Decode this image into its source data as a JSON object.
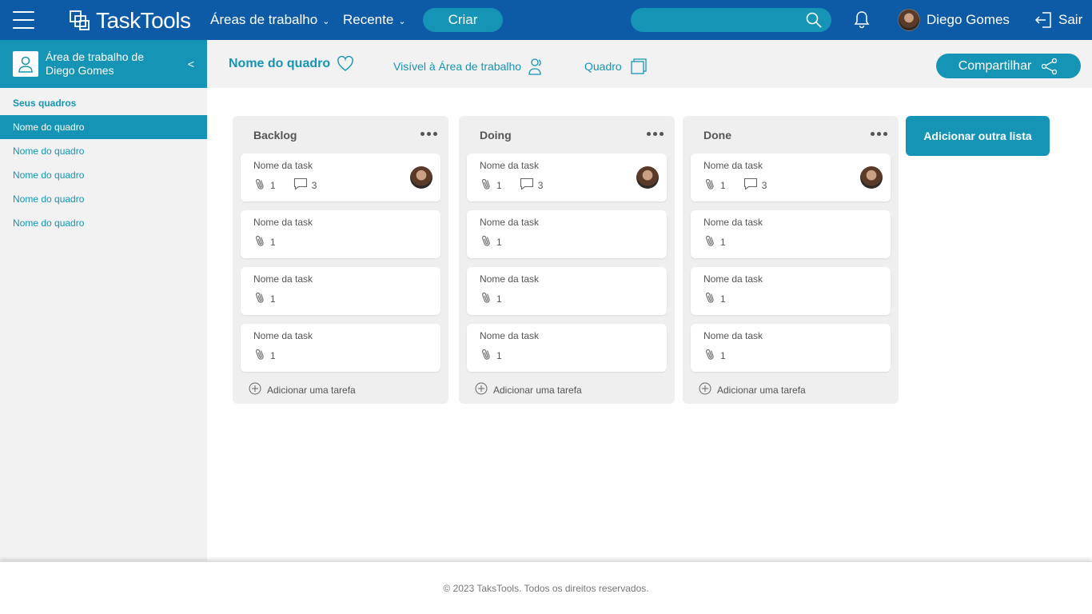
{
  "nav": {
    "logo_text": "TaskTools",
    "workspaces_label": "Áreas de trabalho",
    "recent_label": "Recente",
    "create_label": "Criar",
    "search_placeholder": "",
    "user_name": "Diego Gomes",
    "logout_label": "Sair"
  },
  "sidebar": {
    "workspace_title": "Área de trabalho  de Diego Gomes",
    "collapse_glyph": "<",
    "boards_label": "Seus quadros",
    "boards": [
      {
        "label": "Nome do quadro",
        "active": true
      },
      {
        "label": "Nome do quadro",
        "active": false
      },
      {
        "label": "Nome do quadro",
        "active": false
      },
      {
        "label": "Nome do quadro",
        "active": false
      },
      {
        "label": "Nome do quadro",
        "active": false
      }
    ]
  },
  "board_header": {
    "title": "Nome do quadro",
    "visibility": "Visível à Área de trabalho",
    "view": "Quadro",
    "share_label": "Compartilhar"
  },
  "lists": [
    {
      "title": "Backlog",
      "add_task_label": "Adicionar uma tarefa",
      "cards": [
        {
          "name": "Nome da task",
          "attachments": "1",
          "comments": "3",
          "has_avatar": true
        },
        {
          "name": "Nome da task",
          "attachments": "1"
        },
        {
          "name": "Nome da task",
          "attachments": "1"
        },
        {
          "name": "Nome da task",
          "attachments": "1"
        }
      ]
    },
    {
      "title": "Doing",
      "add_task_label": "Adicionar uma tarefa",
      "cards": [
        {
          "name": "Nome da task",
          "attachments": "1",
          "comments": "3",
          "has_avatar": true
        },
        {
          "name": "Nome da task",
          "attachments": "1"
        },
        {
          "name": "Nome da task",
          "attachments": "1"
        },
        {
          "name": "Nome da task",
          "attachments": "1"
        }
      ]
    },
    {
      "title": "Done",
      "add_task_label": "Adicionar uma tarefa",
      "cards": [
        {
          "name": "Nome da task",
          "attachments": "1",
          "comments": "3",
          "has_avatar": true
        },
        {
          "name": "Nome da task",
          "attachments": "1"
        },
        {
          "name": "Nome da task",
          "attachments": "1"
        },
        {
          "name": "Nome da task",
          "attachments": "1"
        }
      ]
    }
  ],
  "add_list_label": "Adicionar outra lista",
  "footer": {
    "text": "© 2023 TaksTools. Todos os direitos reservados."
  },
  "colors": {
    "nav_bg": "#0d5aa7",
    "accent": "#1594b5",
    "panel_bg": "#f2f2f2"
  },
  "icons": [
    "menu-icon",
    "logo-icon",
    "chevron-down-icon",
    "search-icon",
    "bell-icon",
    "logout-icon",
    "user-icon",
    "heart-icon",
    "people-icon",
    "board-icon",
    "share-icon",
    "more-icon",
    "paperclip-icon",
    "comment-icon",
    "plus-circle-icon"
  ]
}
